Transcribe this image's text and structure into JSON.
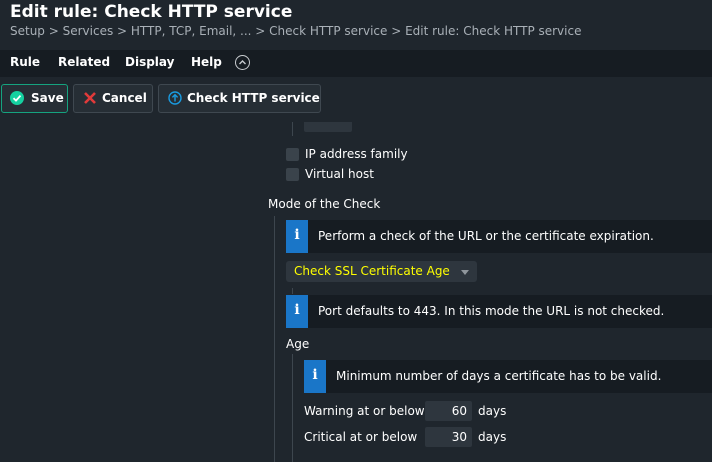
{
  "header": {
    "title": "Edit rule: Check HTTP service",
    "breadcrumb": "Setup > Services > HTTP, TCP, Email, ... > Check HTTP service > Edit rule: Check HTTP service"
  },
  "menu": {
    "items": [
      "Rule",
      "Related",
      "Display",
      "Help"
    ],
    "active": "Rule"
  },
  "toolbar": {
    "save_label": "Save",
    "cancel_label": "Cancel",
    "check_label": "Check HTTP service"
  },
  "form": {
    "ip_family_label": "IP address family",
    "virtual_host_label": "Virtual host",
    "mode_title": "Mode of the Check",
    "mode_info": "Perform a check of the URL or the certificate expiration.",
    "mode_selected": "Check SSL Certificate Age",
    "port_info": "Port defaults to 443. In this mode the URL is not checked.",
    "age_title": "Age",
    "age_info": "Minimum number of days a certificate has to be valid.",
    "warning_label": "Warning at or below",
    "warning_value": "60",
    "critical_label": "Critical at or below",
    "critical_value": "30",
    "unit": "days"
  },
  "colors": {
    "background": "#1f262d",
    "menubar": "#161c22",
    "accent": "#15d1a0",
    "info": "#1a76c8",
    "cancel": "#e03a3a",
    "highlight_text": "#ffff00"
  }
}
